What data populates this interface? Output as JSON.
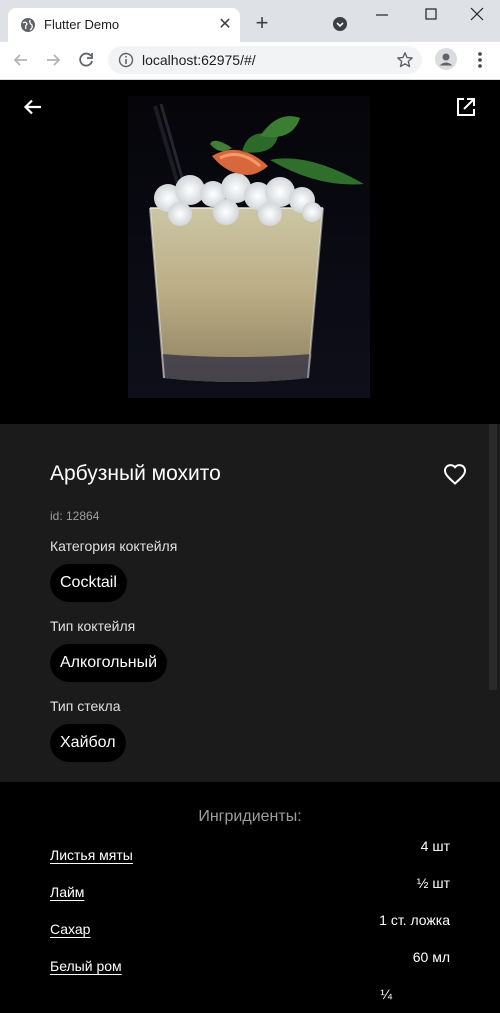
{
  "browser": {
    "tab_title": "Flutter Demo",
    "url": "localhost:62975/#/"
  },
  "cocktail": {
    "name": "Арбузный мохито",
    "id_text": "id: 12864",
    "category_label": "Категория коктейля",
    "category": "Cocktail",
    "type_label": "Тип коктейля",
    "type": "Алкогольный",
    "glass_label": "Тип стекла",
    "glass": "Хайбол"
  },
  "ingredients": {
    "title": "Ингридиенты:",
    "items": [
      {
        "name": "Листья мяты",
        "measure": "4 шт"
      },
      {
        "name": "Лайм",
        "measure": "½ шт"
      },
      {
        "name": "Сахар",
        "measure": "1 ст. ложка"
      },
      {
        "name": "Белый ром",
        "measure": "60 мл"
      },
      {
        "name": "",
        "measure": "¼"
      }
    ]
  },
  "icons": {
    "back": "arrow-back-icon",
    "open": "open-in-new-icon",
    "favorite": "heart-outline-icon"
  }
}
